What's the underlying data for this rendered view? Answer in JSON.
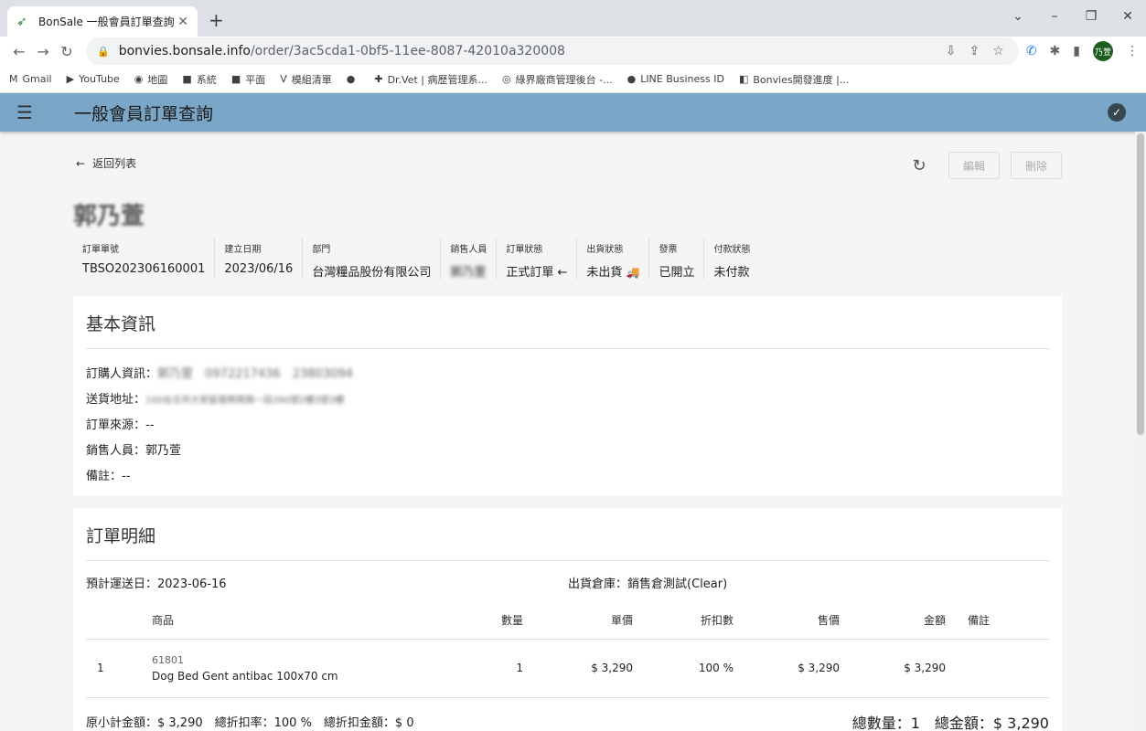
{
  "browser": {
    "tab_title": "BonSale 一般會員訂單查詢",
    "url_host": "bonvies.bonsale.info",
    "url_path": "/order/3ac5cda1-0bf5-11ee-8087-42010a320008",
    "profile": "乃萱",
    "bookmarks": [
      {
        "label": "Gmail",
        "icon": "M"
      },
      {
        "label": "YouTube",
        "icon": "▶"
      },
      {
        "label": "地圖",
        "icon": "◉"
      },
      {
        "label": "系統",
        "icon": "■"
      },
      {
        "label": "平面",
        "icon": "■"
      },
      {
        "label": "模組清單",
        "icon": "V"
      },
      {
        "label": "",
        "icon": "●"
      },
      {
        "label": "Dr.Vet | 病歷管理系...",
        "icon": "✚"
      },
      {
        "label": "綠界廠商管理後台 -...",
        "icon": "◎"
      },
      {
        "label": "LINE Business ID",
        "icon": "●"
      },
      {
        "label": "Bonvies開發進度 |...",
        "icon": "◧"
      }
    ]
  },
  "app": {
    "title": "一般會員訂單查詢"
  },
  "page": {
    "back_label": "返回列表",
    "edit_label": "編輯",
    "delete_label": "刪除",
    "customer_name": "郭乃萱",
    "meta": [
      {
        "label": "訂單單號",
        "value": "TBSO202306160001"
      },
      {
        "label": "建立日期",
        "value": "2023/06/16"
      },
      {
        "label": "部門",
        "value": "台灣糧品股份有限公司"
      },
      {
        "label": "銷售人員",
        "value": "郭乃萱"
      },
      {
        "label": "訂單狀態",
        "value": "正式訂單 ←"
      },
      {
        "label": "出貨狀態",
        "value": "未出貨"
      },
      {
        "label": "發票",
        "value": "已開立"
      },
      {
        "label": "付款狀態",
        "value": "未付款"
      }
    ]
  },
  "basic": {
    "title": "基本資訊",
    "buyer_label": "訂購人資訊：",
    "buyer_value": "郭乃萱　0972217436　23803094",
    "address_label": "送貨地址：",
    "address_value": "100台北市大安區復興南路一段390號2樓3號3樓",
    "source_label": "訂單來源：",
    "source_value": "--",
    "sales_label": "銷售人員：",
    "sales_value": "郭乃萱",
    "note_label": "備註：",
    "note_value": "--"
  },
  "detail": {
    "title": "訂單明細",
    "ship_date": "預計運送日：2023-06-16",
    "warehouse": "出貨倉庫：銷售倉測試(Clear)",
    "headers": {
      "product": "商品",
      "qty": "數量",
      "unit": "單價",
      "discount": "折扣數",
      "price": "售價",
      "amount": "金額",
      "note": "備註"
    },
    "rows": [
      {
        "no": "1",
        "sku": "61801",
        "name": "Dog Bed Gent antibac 100x70 cm",
        "qty": "1",
        "unit": "$ 3,290",
        "discount": "100 %",
        "price": "$ 3,290",
        "amount": "$ 3,290",
        "note": ""
      }
    ],
    "subtotal": "原小計金額：$ 3,290　總折扣率：100 %　總折扣金額：$ 0",
    "total": "總數量：1　總金額：$ 3,290"
  }
}
